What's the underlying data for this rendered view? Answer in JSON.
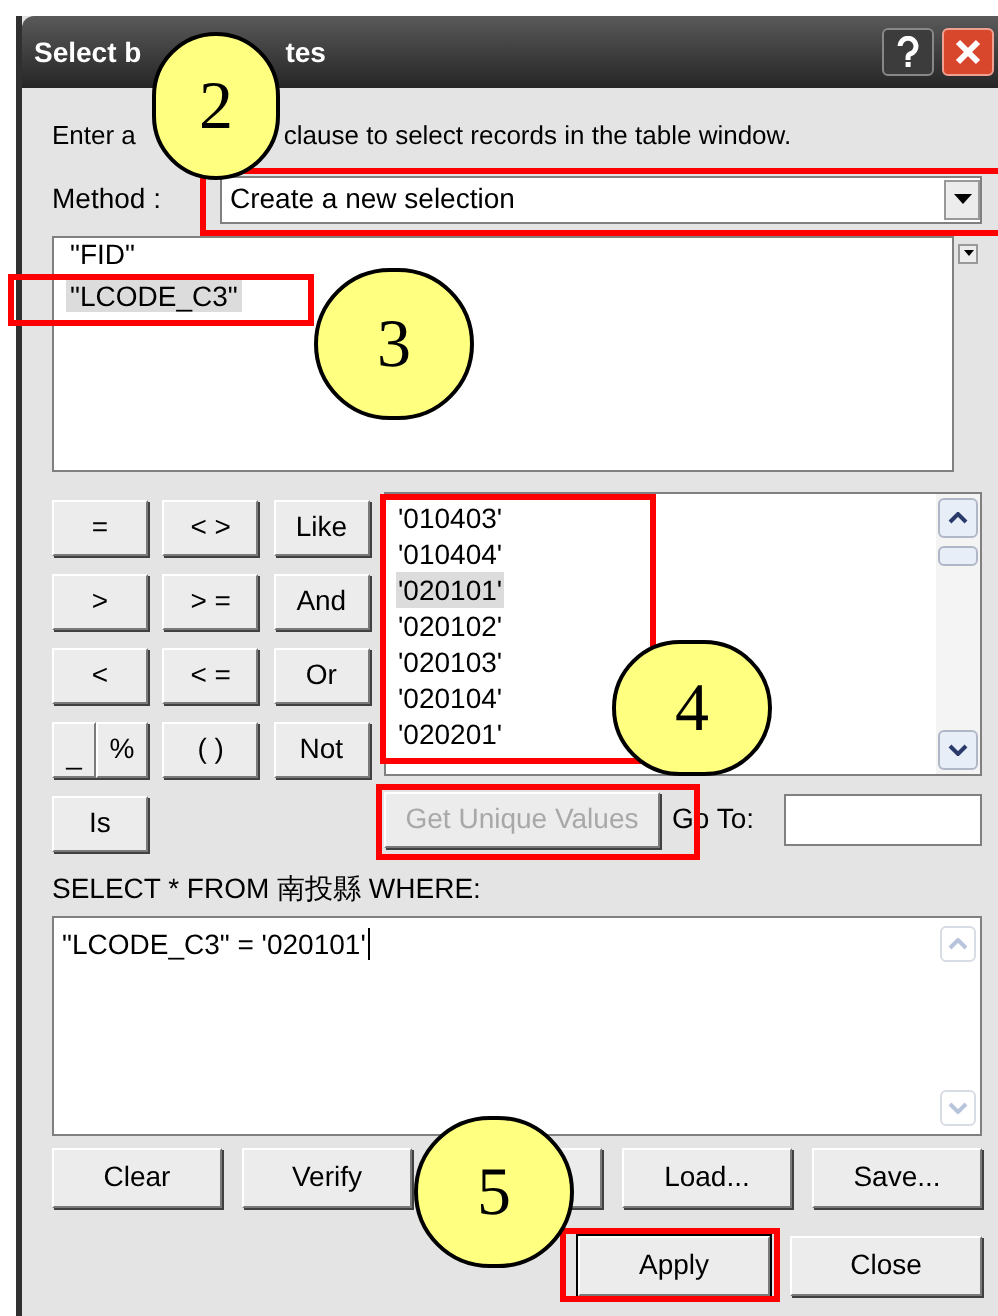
{
  "window": {
    "title_parts": [
      "Select b",
      "tes"
    ]
  },
  "instruction_parts": [
    "Enter a",
    "clause to select records in the table window."
  ],
  "method": {
    "label": "Method :",
    "value": "Create a new selection"
  },
  "fields": [
    {
      "text": "\"FID\"",
      "selected": false
    },
    {
      "text": "\"LCODE_C3\"",
      "selected": true
    }
  ],
  "operators": [
    {
      "label": "="
    },
    {
      "label": "< >"
    },
    {
      "label": "Like"
    },
    {
      "label": ">"
    },
    {
      "label": "> ="
    },
    {
      "label": "And"
    },
    {
      "label": "<"
    },
    {
      "label": "< ="
    },
    {
      "label": "Or"
    },
    {
      "label": "_",
      "kind": "split"
    },
    {
      "label": "%",
      "kind": "split"
    },
    {
      "label": "( )"
    },
    {
      "label": "Not"
    },
    {
      "label": "Is"
    }
  ],
  "values": [
    {
      "text": "'010403'",
      "selected": false
    },
    {
      "text": "'010404'",
      "selected": false
    },
    {
      "text": "'020101'",
      "selected": true
    },
    {
      "text": "'020102'",
      "selected": false
    },
    {
      "text": "'020103'",
      "selected": false
    },
    {
      "text": "'020104'",
      "selected": false
    },
    {
      "text": "'020201'",
      "selected": false
    }
  ],
  "get_unique_values": {
    "label": "Get Unique Values",
    "disabled": true
  },
  "go_to": {
    "label": "Go To:"
  },
  "query_label": "SELECT * FROM 南投縣 WHERE:",
  "expression": "\"LCODE_C3\" = '020101'",
  "buttons": [
    {
      "kind": "text",
      "label": "Clear"
    },
    {
      "kind": "text",
      "label": "Verify"
    },
    {
      "kind": "covered"
    },
    {
      "kind": "text",
      "label": "Load..."
    },
    {
      "kind": "text",
      "label": "Save..."
    }
  ],
  "footer_buttons": [
    {
      "label": "Apply",
      "selected": true
    },
    {
      "label": "Close",
      "selected": false
    }
  ],
  "callouts": [
    {
      "label": "2"
    },
    {
      "label": "3"
    },
    {
      "label": "4"
    },
    {
      "label": "5"
    }
  ]
}
